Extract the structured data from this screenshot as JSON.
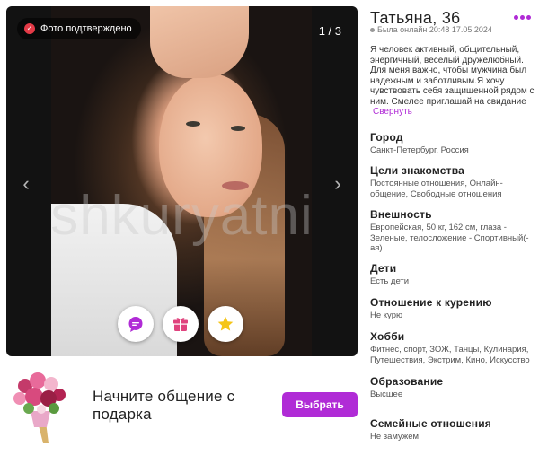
{
  "profile": {
    "name_age": "Татьяна, 36",
    "online_status": "Была онлайн 20:48 17.05.2024",
    "bio": "Я человек активный, общительный, энергичный, веселый дружелюбный. Для меня важно, чтобы мужчина был надежным и заботливым.Я хочу чувствовать себя защищенной рядом с ним. Смелее приглашай на свидание",
    "collapse_label": "Свернуть"
  },
  "photo": {
    "verified_label": "Фото подтверждено",
    "counter": "1 / 3",
    "watermark": "shkuryatni"
  },
  "gift": {
    "text": "Начните общение с подарка",
    "button_label": "Выбрать"
  },
  "details": [
    {
      "label": "Город",
      "value": "Санкт-Петербург, Россия"
    },
    {
      "label": "Цели знакомства",
      "value": "Постоянные отношения, Онлайн-общение, Свободные отношения"
    },
    {
      "label": "Внешность",
      "value": "Европейская, 50 кг, 162 см, глаза - Зеленые, телосложение - Спортивный(-ая)"
    },
    {
      "label": "Дети",
      "value": "Есть дети"
    },
    {
      "label": "Отношение к курению",
      "value": "Не курю"
    },
    {
      "label": "Хобби",
      "value": "Фитнес, спорт, ЗОЖ, Танцы, Кулинария, Путешествия, Экстрим, Кино, Искусство"
    },
    {
      "label": "Образование",
      "value": "Высшее"
    },
    {
      "label": "Семейные отношения",
      "value": "Не замужем"
    }
  ],
  "colors": {
    "accent": "#b02bd6",
    "verified": "#e43a47",
    "star": "#f5c518"
  },
  "icons": {
    "message": "chat-bubble",
    "gift": "gift-box",
    "favorite": "star",
    "more": "three-dots"
  }
}
